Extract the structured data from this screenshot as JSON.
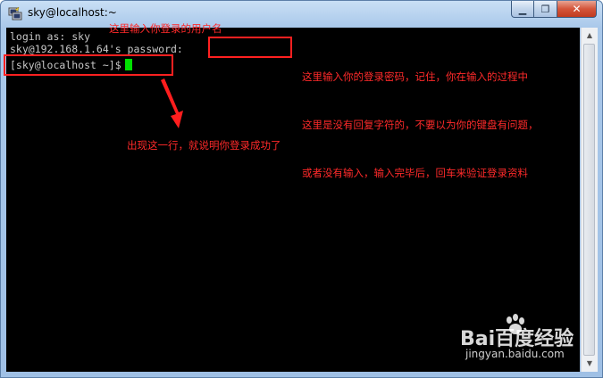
{
  "window": {
    "title": "sky@localhost:~",
    "controls": {
      "minimize": "▁",
      "maximize": "❐",
      "close": "✕"
    }
  },
  "terminal": {
    "lines": [
      "login as: sky",
      "sky@192.168.1.64's password:",
      "[sky@localhost ~]$"
    ]
  },
  "annotations": {
    "username_note": "这里输入你登录的用户名",
    "password_note": [
      "这里输入你的登录密码，记住，你在输入的过程中",
      "这里是没有回复字符的，不要以为你的键盘有问题，",
      "或者没有输入，输入完毕后，回车来验证登录资料"
    ],
    "success_note": "出现这一行，就说明你登录成功了"
  },
  "watermark": {
    "logo": "Bai百度经验",
    "url": "jingyan.baidu.com"
  },
  "colors": {
    "annotation": "#ff2a2a",
    "cursor": "#00e000",
    "terminal_bg": "#000000",
    "terminal_fg": "#c8c8c8"
  },
  "icons": [
    "putty-icon",
    "minimize-icon",
    "maximize-icon",
    "close-icon",
    "scroll-up-icon",
    "scroll-down-icon",
    "arrow-icon",
    "baidu-paw-icon"
  ]
}
